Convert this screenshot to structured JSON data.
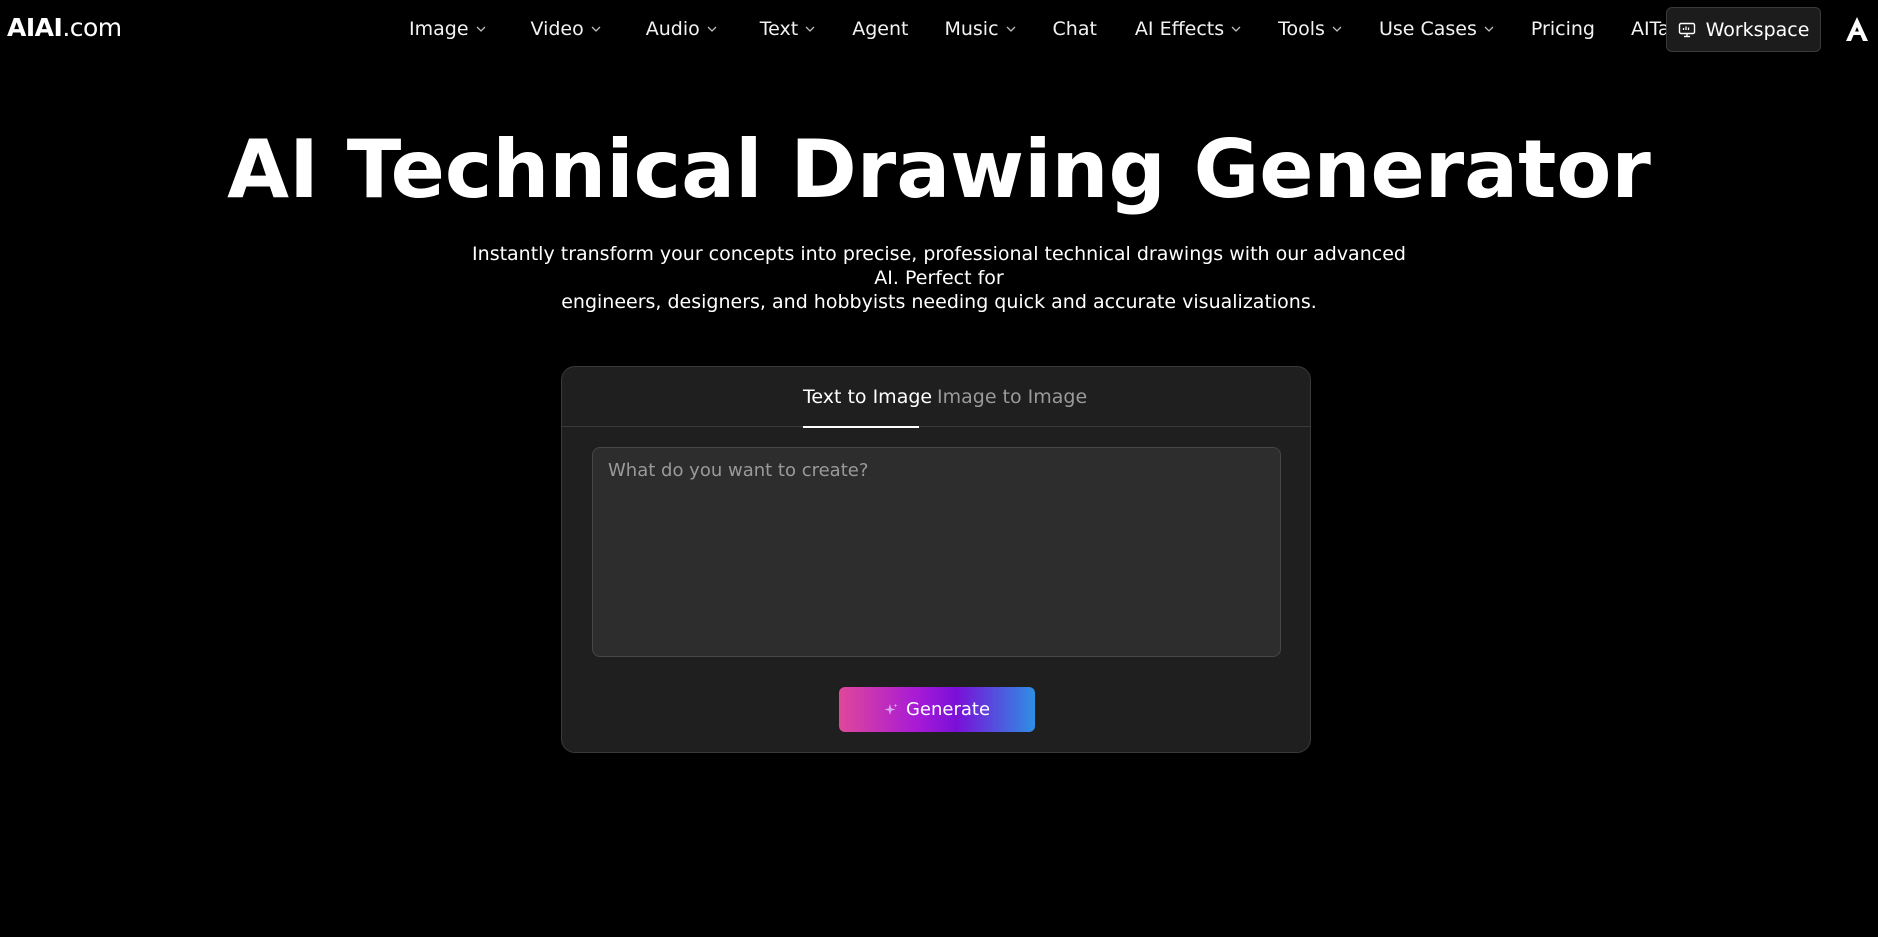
{
  "colors": {
    "background": "#000000",
    "panel": "#1f1f1f",
    "input_bg": "#2d2d2d",
    "border": "#3a3a3a",
    "gradient_start": "#e0479a",
    "gradient_mid": "#7a10d8",
    "gradient_end": "#2e8fe4"
  },
  "header": {
    "logo_bold": "AIAI",
    "logo_rest": ".com",
    "nav": [
      {
        "label": "Image",
        "dropdown": true
      },
      {
        "label": "Video",
        "dropdown": true
      },
      {
        "label": "Audio",
        "dropdown": true
      },
      {
        "label": "Text",
        "dropdown": true
      },
      {
        "label": "Agent",
        "dropdown": false
      },
      {
        "label": "Music",
        "dropdown": true
      },
      {
        "label": "Chat",
        "dropdown": false
      },
      {
        "label": "AI Effects",
        "dropdown": true
      },
      {
        "label": "Tools",
        "dropdown": true
      },
      {
        "label": "Use Cases",
        "dropdown": true
      },
      {
        "label": "Pricing",
        "dropdown": false
      },
      {
        "label": "AITab",
        "dropdown": false
      }
    ],
    "workspace_label": "Workspace",
    "workspace_icon": "monitor-icon",
    "brand_icon": "brand-a-icon"
  },
  "hero": {
    "title": "AI Technical Drawing Generator",
    "subtitle_line1": "Instantly transform your concepts into precise, professional technical drawings with our advanced AI. Perfect for",
    "subtitle_line2": "engineers, designers, and hobbyists needing quick and accurate visualizations."
  },
  "generator": {
    "tabs": [
      {
        "label": "Text to Image",
        "active": true
      },
      {
        "label": "Image to Image",
        "active": false
      }
    ],
    "prompt": {
      "value": "",
      "placeholder": "What do you want to create?"
    },
    "generate_label": "Generate",
    "generate_icon": "sparkle-icon"
  }
}
